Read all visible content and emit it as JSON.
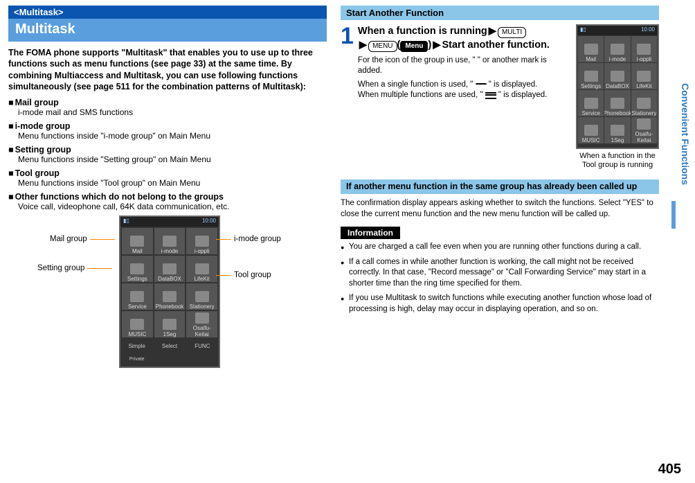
{
  "left": {
    "tag": "<Multitask>",
    "title": "Multitask",
    "desc": "The FOMA phone supports \"Multitask\" that enables you to use up to three functions such as menu functions (see page 33) at the same time. By combining Multiaccess and Multitask, you can use following functions simultaneously (see page 511 for the combination patterns of Multitask):",
    "groups": [
      {
        "head": "Mail group",
        "sub": "i-mode mail and SMS functions"
      },
      {
        "head": "i-mode group",
        "sub": "Menu functions inside \"i-mode group\" on Main Menu"
      },
      {
        "head": "Setting group",
        "sub": "Menu functions inside \"Setting group\" on Main Menu"
      },
      {
        "head": "Tool group",
        "sub": "Menu functions inside \"Tool group\" on Main Menu"
      },
      {
        "head": "Other functions which do not belong to the groups",
        "sub": "Voice call, videophone call, 64K data communication, etc."
      }
    ],
    "labels": {
      "mail": "Mail group",
      "setting": "Setting group",
      "imode": "i-mode group",
      "tool": "Tool group"
    },
    "menu": {
      "cells": [
        "Mail",
        "i-mode",
        "i-αppli",
        "Settings",
        "DataBOX",
        "LifeKit",
        "Service",
        "Phonebook",
        "Stationery",
        "MUSIC",
        "1Seg",
        "Osaifu-Keitai"
      ],
      "soft": [
        "Simple",
        "Select",
        "FUNC"
      ],
      "softSub": "Private"
    }
  },
  "right": {
    "header": "Start Another Function",
    "stepNum": "1",
    "stepHead1": "When a function is running",
    "keyMulti": "MULTI",
    "keyMenu": "MENU",
    "keyMenuInv": "Menu",
    "stepHead2": "Start another function.",
    "stepDesc1": "For the icon of the group in use, \"     \" or another mark is added.",
    "stepDesc2a": "When a single function is used, \" ",
    "stepDesc2b": " \" is displayed.",
    "stepDesc3a": "When multiple functions are used, \" ",
    "stepDesc3b": " \" is displayed.",
    "phoneCaption": "When a function in the Tool group is running",
    "noteHead": "If another menu function in the same group has already been called up",
    "noteBody": "The confirmation display appears asking whether to switch the functions. Select \"YES\" to close the current menu function and the new menu function will be called up.",
    "infoHead": "Information",
    "info": [
      "You are charged a call fee even when you are running other functions during a call.",
      "If a call comes in while another function is working, the call might not be received correctly. In that case, \"Record message\" or \"Call Forwarding Service\" may start in a shorter time than the ring time specified for them.",
      "If you use Multitask to switch functions while executing another function whose load of processing is high, delay may occur in displaying operation, and so on."
    ]
  },
  "sideTab": "Convenient Functions",
  "pageNum": "405"
}
